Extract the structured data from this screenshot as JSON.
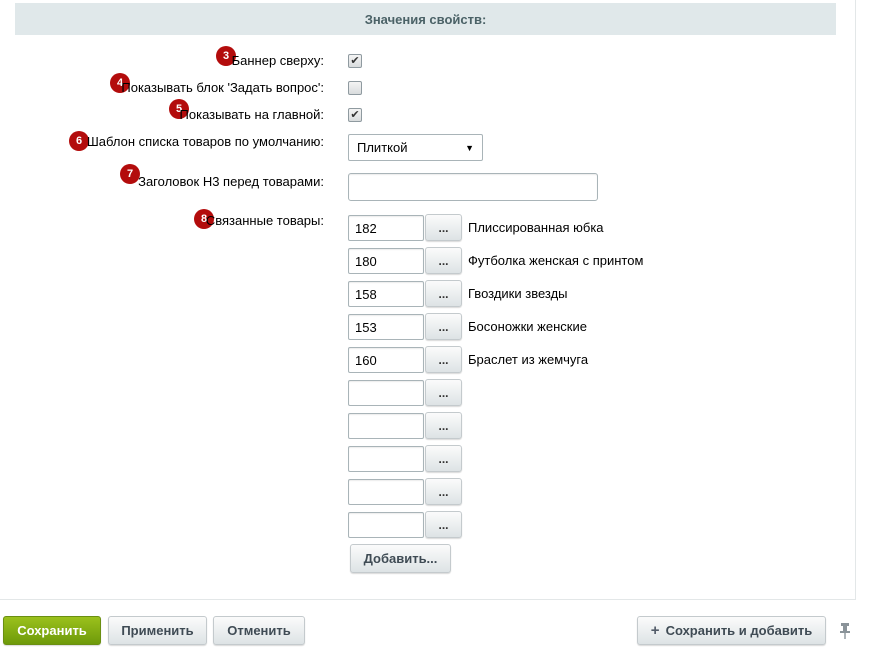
{
  "section": {
    "title": "Значения свойств:"
  },
  "fields": {
    "banner_top": {
      "badge": "3",
      "label": "Баннер сверху:",
      "checked": true,
      "check_glyph": "✔"
    },
    "ask_question": {
      "badge": "4",
      "label": "Показывать блок 'Задать вопрос':",
      "checked": false,
      "check_glyph": ""
    },
    "show_main": {
      "badge": "5",
      "label": "Показывать на главной:",
      "checked": true,
      "check_glyph": "✔"
    },
    "list_template": {
      "badge": "6",
      "label": "Шаблон списка товаров по умолчанию:",
      "value": "Плиткой",
      "arrow": "▼"
    },
    "h3_title": {
      "badge": "7",
      "label": "Заголовок H3 перед товарами:",
      "value": ""
    },
    "related": {
      "badge": "8",
      "label": "Связанные товары:",
      "browse_label": "...",
      "add_label": "Добавить...",
      "items": [
        {
          "id": "182",
          "name": "Плиссированная юбка"
        },
        {
          "id": "180",
          "name": "Футболка женская с принтом"
        },
        {
          "id": "158",
          "name": "Гвоздики звезды"
        },
        {
          "id": "153",
          "name": "Босоножки женские"
        },
        {
          "id": "160",
          "name": "Браслет из жемчуга"
        },
        {
          "id": "",
          "name": ""
        },
        {
          "id": "",
          "name": ""
        },
        {
          "id": "",
          "name": ""
        },
        {
          "id": "",
          "name": ""
        },
        {
          "id": "",
          "name": ""
        }
      ]
    }
  },
  "footer": {
    "save": "Сохранить",
    "apply": "Применить",
    "cancel": "Отменить",
    "save_add": "Сохранить и добавить",
    "save_add_icon": "plus-icon",
    "pin_icon": "pin-icon"
  },
  "colors": {
    "save_button": "#8bb414",
    "badge": "#b30c0c",
    "header_bg": "#e0e8ea"
  }
}
